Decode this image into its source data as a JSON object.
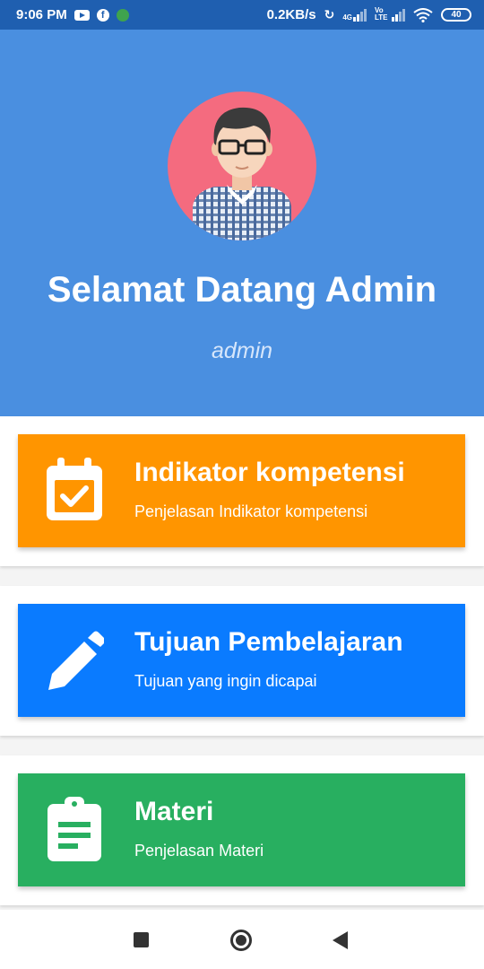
{
  "status_bar": {
    "time": "9:06 PM",
    "net_speed": "0.2KB/s",
    "network_label": "4G",
    "volte_label": "Vo LTE",
    "battery": "40"
  },
  "header": {
    "title": "Selamat Datang Admin",
    "username": "admin",
    "background_color": "#4a8fe0"
  },
  "menu": [
    {
      "title": "Indikator kompetensi",
      "subtitle": "Penjelasan Indikator kompetensi",
      "icon": "calendar-check-icon",
      "color": "#ff9500"
    },
    {
      "title": "Tujuan Pembelajaran",
      "subtitle": "Tujuan yang ingin dicapai",
      "icon": "pencil-icon",
      "color": "#0a7bff"
    },
    {
      "title": "Materi",
      "subtitle": "Penjelasan Materi",
      "icon": "clipboard-icon",
      "color": "#28af60"
    }
  ],
  "nav_bar": {
    "recent_icon": "square-icon",
    "home_icon": "circle-icon",
    "back_icon": "triangle-back-icon"
  }
}
